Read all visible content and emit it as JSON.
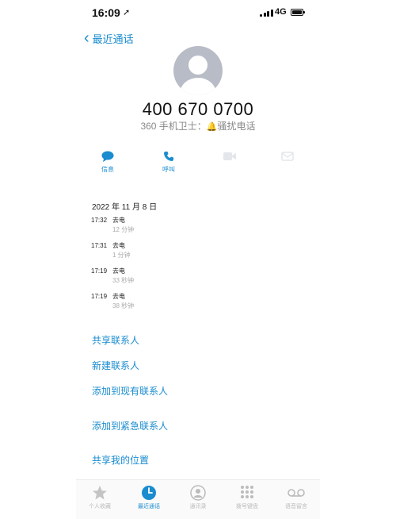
{
  "status_bar": {
    "time": "16:09",
    "location_glyph": "➚",
    "network": "4G"
  },
  "nav": {
    "back_label": "最近通话"
  },
  "contact": {
    "number": "400 670 0700",
    "tag_prefix": "360 手机卫士：",
    "tag_label": "骚扰电话"
  },
  "actions": [
    {
      "label": "信息",
      "icon": "message-icon",
      "enabled": true
    },
    {
      "label": "呼叫",
      "icon": "phone-icon",
      "enabled": true
    },
    {
      "label": "",
      "icon": "video-icon",
      "enabled": false
    },
    {
      "label": "",
      "icon": "mail-icon",
      "enabled": false
    }
  ],
  "history": {
    "date": "2022 年 11 月 8 日",
    "calls": [
      {
        "time": "17:32",
        "type": "去电",
        "duration": "12 分钟"
      },
      {
        "time": "17:31",
        "type": "去电",
        "duration": "1 分钟"
      },
      {
        "time": "17:19",
        "type": "去电",
        "duration": "33 秒钟"
      },
      {
        "time": "17:19",
        "type": "去电",
        "duration": "38 秒钟"
      }
    ]
  },
  "links": {
    "share_contact": "共享联系人",
    "new_contact": "新建联系人",
    "add_existing": "添加到现有联系人",
    "add_emergency": "添加到紧急联系人",
    "share_location": "共享我的位置"
  },
  "tabs": [
    {
      "label": "个人收藏",
      "icon": "star-icon",
      "active": false
    },
    {
      "label": "最近通话",
      "icon": "clock-icon",
      "active": true
    },
    {
      "label": "通讯录",
      "icon": "contacts-icon",
      "active": false
    },
    {
      "label": "拨号键盘",
      "icon": "keypad-icon",
      "active": false
    },
    {
      "label": "语音留言",
      "icon": "voicemail-icon",
      "active": false
    }
  ],
  "colors": {
    "accent": "#1a8ccf",
    "warning": "#e2683a",
    "inactive": "#bbbbbb"
  }
}
